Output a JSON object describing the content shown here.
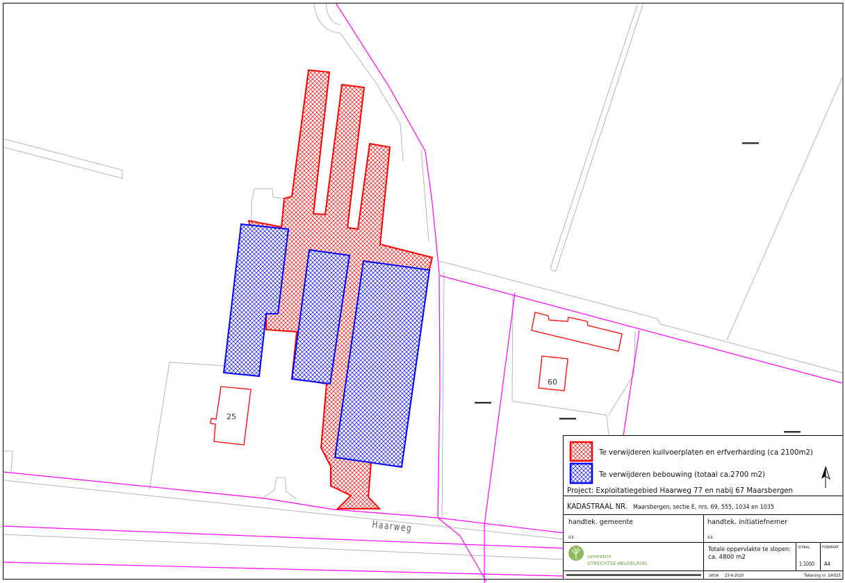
{
  "map": {
    "road_label": "Haarweg",
    "house_numbers": {
      "left": "25",
      "right": "60"
    },
    "colors": {
      "demolition_paving": "#ff0000",
      "demolition_buildings": "#0000ff",
      "cadastral_boundary": "#ff00ff",
      "topographic_line": "#b4b4b4"
    }
  },
  "legend": {
    "items": [
      {
        "label": "Te verwijderen kuilvoerplaten en erfverharding (ca 2100m2)",
        "color": "#ff0000"
      },
      {
        "label": "Te verwijderen bebouwing (totaal ca.2700 m2)",
        "color": "#0000ff"
      }
    ],
    "north_arrow_icon": "north-arrow-icon",
    "project": "Project: Exploitatiegebied Haarweg 77 en nabij 67 Maarsbergen"
  },
  "title_block": {
    "kadastraal_label": "KADASTRAAL NR.",
    "kadastraal_value": "Maarsbergen, sectie E, nrs. 69, 555, 1034 en 1035",
    "signature_municipality": "handtek. gemeente",
    "signature_initiator": "handtek. initiatiefnemer",
    "date_label_left": "d.d.",
    "date_label_right": "d.d.",
    "logo_icon": "tree-emblem-icon",
    "logo_color": "#6aa43c",
    "logo_line1": "GEMEENTE",
    "logo_line2": "UTRECHTSE HEUVELRUG",
    "area_label": "Totale oppervlakte te slopen:",
    "area_value": "ca. 4800 m2",
    "scale_label": "SCHAAL",
    "scale_value": "1:1000",
    "format_label": "FORMAAT",
    "format_value": "A4",
    "date_caption": "DATUM",
    "date_value": "23-4-2020",
    "drawing_number": "Tekening nr. UH025"
  }
}
